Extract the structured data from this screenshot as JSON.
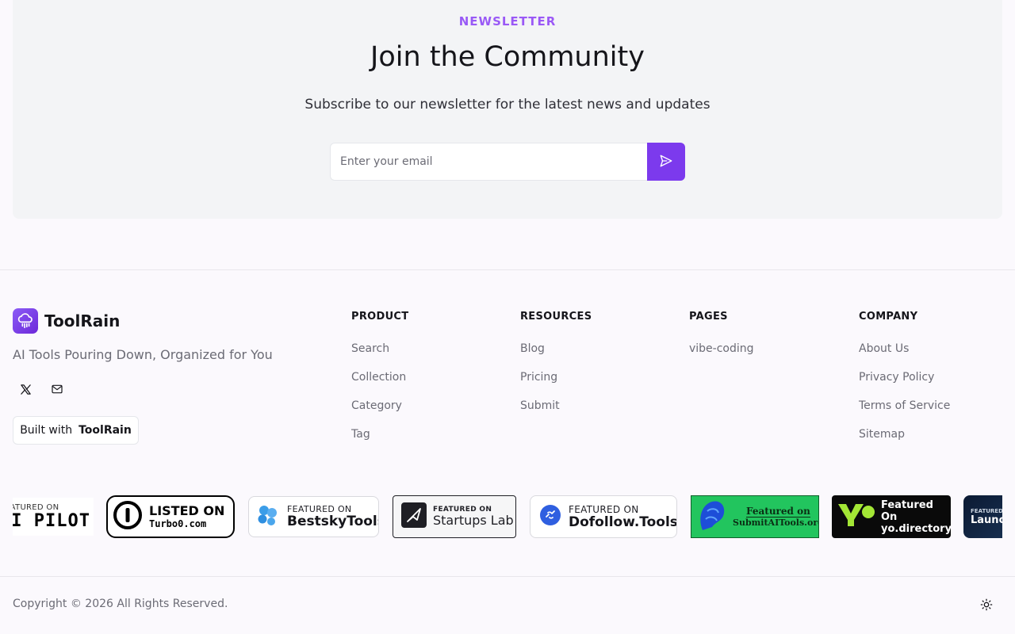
{
  "newsletter": {
    "eyebrow": "NEWSLETTER",
    "title": "Join the Community",
    "subtitle": "Subscribe to our newsletter for the latest news and updates",
    "email_placeholder": "Enter your email",
    "submit_icon": "send-icon",
    "accent": "#7c3aed"
  },
  "brand": {
    "name": "ToolRain",
    "tagline": "AI Tools Pouring Down, Organized for You",
    "logo_icon": "cloud-rain-icon",
    "socials": [
      {
        "icon": "x-twitter-icon"
      },
      {
        "icon": "mail-icon"
      }
    ],
    "built_with_label": "Built with",
    "built_with_brand": "ToolRain"
  },
  "columns": [
    {
      "title": "PRODUCT",
      "links": [
        "Search",
        "Collection",
        "Category",
        "Tag"
      ]
    },
    {
      "title": "RESOURCES",
      "links": [
        "Blog",
        "Pricing",
        "Submit"
      ]
    },
    {
      "title": "PAGES",
      "links": [
        "vibe-coding"
      ]
    },
    {
      "title": "COMPANY",
      "links": [
        "About Us",
        "Privacy Policy",
        "Terms of Service",
        "Sitemap"
      ]
    }
  ],
  "badges": {
    "aipilot": {
      "small": "FEATURED ON",
      "big": "AI PILOT"
    },
    "turbo0": {
      "small": "LISTED ON",
      "big": "Turbo0.com"
    },
    "bestsky": {
      "small": "FEATURED ON",
      "big": "BestskyTools"
    },
    "startups": {
      "small": "FEATURED ON",
      "big": "Startups Lab"
    },
    "dofollow": {
      "small": "FEATURED ON",
      "big": "Dofollow.Tools"
    },
    "submitai": {
      "small": "Featured on",
      "big": "SubmitAITools.org"
    },
    "yo": {
      "small": "Featured On",
      "big": "yo.directory"
    },
    "launch": {
      "small": "FEATURED ON",
      "big": "Launch"
    }
  },
  "footer": {
    "copyright": "Copyright © 2026 All Rights Reserved.",
    "theme_icon": "sun-icon"
  }
}
